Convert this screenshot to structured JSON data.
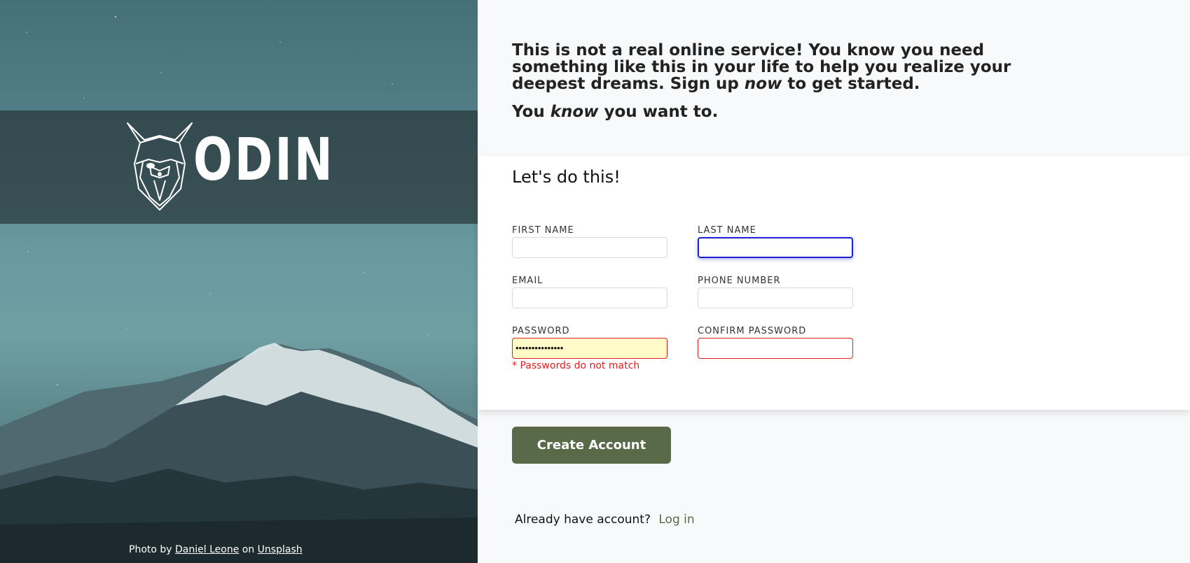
{
  "hero": {
    "brand": "ODIN",
    "credit": {
      "prefix": "Photo by",
      "author": "Daniel Leone",
      "middle": "on",
      "source": "Unsplash"
    }
  },
  "intro": {
    "line1_a": "This is not a real online service! You know you need something like this in your life to help you realize your deepest dreams. Sign up ",
    "line1_em": "now",
    "line1_b": " to get started.",
    "line2_a": "You ",
    "line2_em": "know",
    "line2_b": " you want to."
  },
  "form": {
    "title": "Let's do this!",
    "fields": {
      "first_name": {
        "label": "FIRST NAME",
        "value": ""
      },
      "last_name": {
        "label": "LAST NAME",
        "value": ""
      },
      "email": {
        "label": "EMAIL",
        "value": ""
      },
      "phone": {
        "label": "PHONE NUMBER",
        "value": ""
      },
      "password": {
        "label": "PASSWORD",
        "value": "•••••••••••••••"
      },
      "confirm_password": {
        "label": "CONFIRM PASSWORD",
        "value": ""
      }
    },
    "error": "* Passwords do not match"
  },
  "actions": {
    "create_account": "Create Account",
    "have_account": "Already have account?",
    "login": "Log in"
  },
  "colors": {
    "accent": "#596a48",
    "error": "#e02020",
    "focus": "#2020d0"
  }
}
